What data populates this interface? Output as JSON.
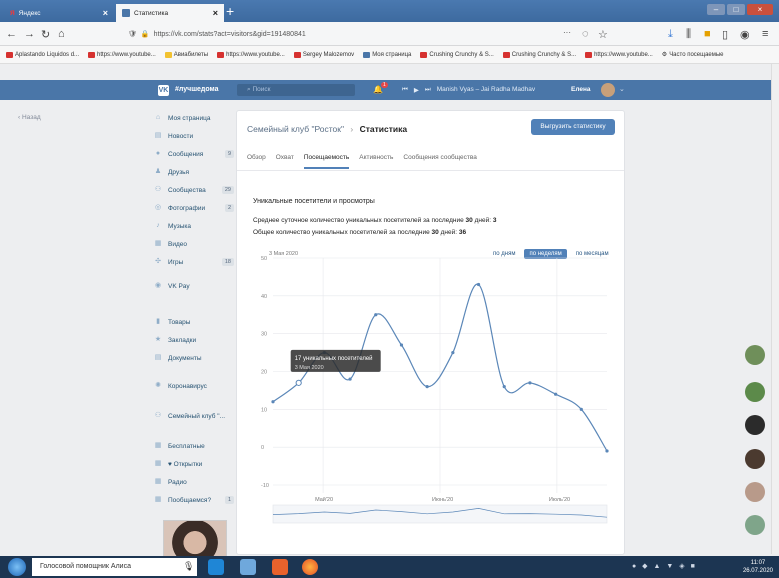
{
  "browser": {
    "tabs": [
      {
        "label": "Яндекс"
      },
      {
        "label": "Статистика"
      }
    ],
    "url": "https://vk.com/stats?act=visitors&gid=191480841",
    "bookmarks": [
      "Aplastando Liquidos d...",
      "https://www.youtube...",
      "Авиабилеты",
      "https://www.youtube...",
      "Sergey Malozemov",
      "Моя страница",
      "Crushing Crunchy & S...",
      "Crushing Crunchy & S...",
      "https://www.youtube...",
      "Часто посещаемые"
    ]
  },
  "vk": {
    "community_tag": "#лучшедома",
    "search_placeholder": "Поиск",
    "notif_count": "1",
    "player_track": "Manish Vyas – Jai Radha Madhav",
    "user_name": "Елена",
    "back_label": "Назад"
  },
  "sidebar": {
    "items": [
      {
        "label": "Моя страница",
        "count": ""
      },
      {
        "label": "Новости",
        "count": ""
      },
      {
        "label": "Сообщения",
        "count": "9"
      },
      {
        "label": "Друзья",
        "count": ""
      },
      {
        "label": "Сообщества",
        "count": "29"
      },
      {
        "label": "Фотографии",
        "count": "2"
      },
      {
        "label": "Музыка",
        "count": ""
      },
      {
        "label": "Видео",
        "count": ""
      },
      {
        "label": "Игры",
        "count": "18"
      },
      {
        "label": "VK Pay",
        "count": ""
      },
      {
        "label": "Товары",
        "count": ""
      },
      {
        "label": "Закладки",
        "count": ""
      },
      {
        "label": "Документы",
        "count": ""
      },
      {
        "label": "Коронавирус",
        "count": ""
      },
      {
        "label": "Семейный клуб \"...",
        "count": ""
      },
      {
        "label": "Бесплатные",
        "count": ""
      },
      {
        "label": "♥ Открытки",
        "count": ""
      },
      {
        "label": "Радио",
        "count": ""
      },
      {
        "label": "Пообщаемся?",
        "count": "1"
      }
    ]
  },
  "panel": {
    "group_name": "Семейный клуб \"Росток\"",
    "separator": "›",
    "page_name": "Статистика",
    "export_label": "Выгрузить статистику",
    "tabs": [
      "Обзор",
      "Охват",
      "Посещаемость",
      "Активность",
      "Сообщения сообщества"
    ],
    "active_tab": "Посещаемость",
    "subtitle": "Уникальные посетители и просмотры",
    "stat1_text": "Среднее суточное количество уникальных посетителей за последние",
    "stat1_days": "30",
    "stat1_days_word": "дней:",
    "stat1_value": "3",
    "stat2_text": "Общее количество уникальных посетителей за последние",
    "stat2_days": "30",
    "stat2_days_word": "дней:",
    "stat2_value": "36",
    "period_buttons": [
      "по дням",
      "по неделям",
      "по месяцам"
    ],
    "active_period": "по неделям"
  },
  "chart_data": {
    "type": "line",
    "start_label": "3 Мая 2020",
    "ylim": [
      -10,
      50
    ],
    "yticks": [
      -10,
      0,
      10,
      20,
      30,
      40,
      50
    ],
    "x_ticks": [
      "Май'20",
      "Июнь'20",
      "Июль'20"
    ],
    "series": [
      {
        "values": [
          12,
          17,
          25,
          18,
          35,
          27,
          16,
          25,
          43,
          16,
          17,
          14,
          10,
          -1
        ]
      }
    ],
    "tooltip": {
      "line1": "17 уникальных посетителей",
      "line2": "3 Мая 2020"
    },
    "colors": {
      "line": "#5b87b8",
      "grid": "#e6e8ec",
      "point": "#5b87b8"
    }
  },
  "taskbar": {
    "assistant": "Голосовой помощник Алиса",
    "time": "11:07",
    "date": "26.07.2020"
  }
}
